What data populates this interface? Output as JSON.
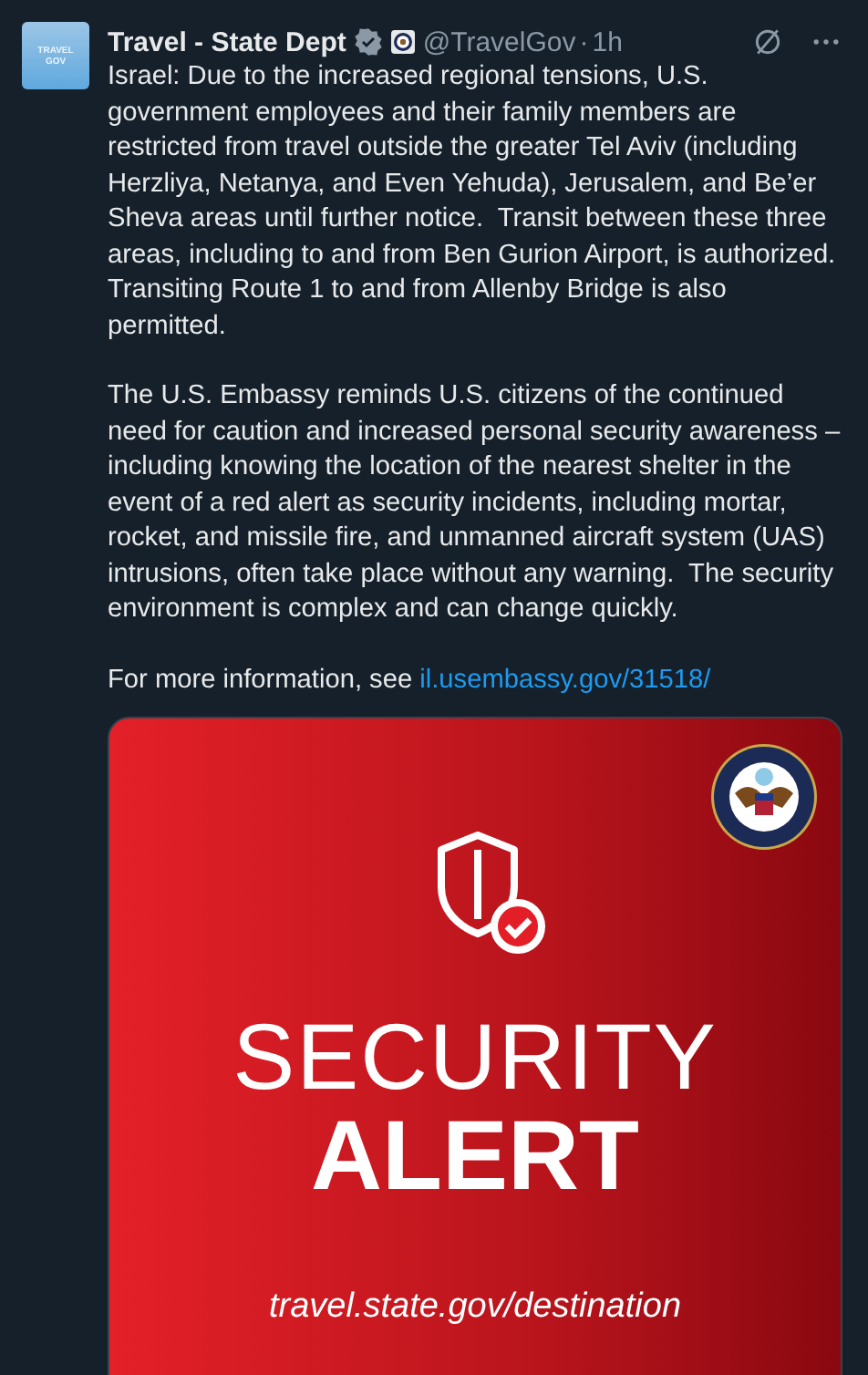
{
  "avatar": {
    "line_1": "TRAVEL",
    "line_2": "GOV"
  },
  "author": {
    "name": "Travel - State Dept",
    "verified": true,
    "handle": "@TravelGov",
    "separator": "·",
    "time": "1h"
  },
  "paragraphs": [
    "Israel: Due to the increased regional tensions, U.S. government employees and their family members are restricted from travel outside the greater Tel Aviv (including Herzliya, Netanya, and Even Yehuda), Jerusalem, and Be’er Sheva areas until further notice.  Transit between these three areas, including to and from Ben Gurion Airport, is authorized.  Transiting Route 1 to and from Allenby Bridge is also permitted.",
    "The U.S. Embassy reminds U.S. citizens of the continued need for caution and increased personal security awareness – including knowing the location of the nearest shelter in the event of a red alert as security incidents, including mortar, rocket, and missile fire, and unmanned aircraft system (UAS) intrusions, often take place without any warning.  The security environment is complex and can change quickly."
  ],
  "more_info": {
    "text": "For more information, see ",
    "link": "il.usembassy.gov/31518/"
  },
  "media": {
    "headline_1": "SECURITY",
    "headline_2": "ALERT",
    "url": "travel.state.gov/destination"
  }
}
